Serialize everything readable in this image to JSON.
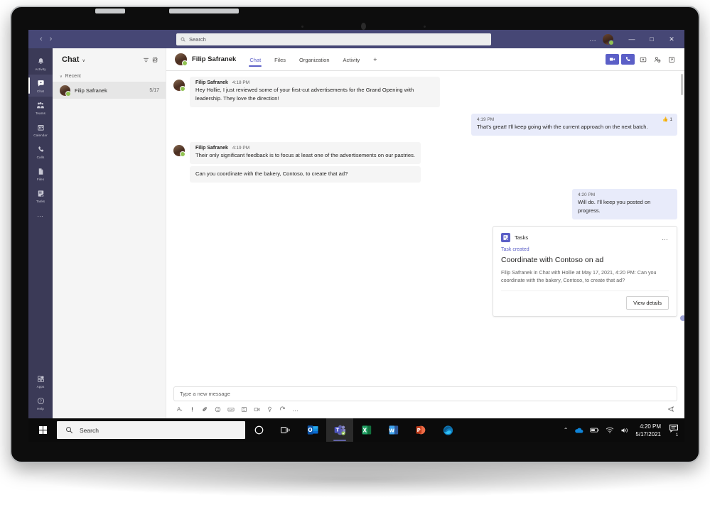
{
  "window": {
    "search_placeholder": "Search",
    "more_label": "…",
    "minimize_label": "—",
    "maximize_label": "□",
    "close_label": "✕",
    "back_label": "‹",
    "forward_label": "›"
  },
  "rail": {
    "items": [
      {
        "label": "Activity",
        "icon": "bell-icon"
      },
      {
        "label": "Chat",
        "icon": "chat-icon"
      },
      {
        "label": "Teams",
        "icon": "teams-icon"
      },
      {
        "label": "Calendar",
        "icon": "calendar-icon"
      },
      {
        "label": "Calls",
        "icon": "phone-icon"
      },
      {
        "label": "Files",
        "icon": "file-icon"
      },
      {
        "label": "Tasks",
        "icon": "tasks-icon"
      }
    ],
    "more_label": "…",
    "bottom_items": [
      {
        "label": "Apps",
        "icon": "apps-icon"
      },
      {
        "label": "Help",
        "icon": "help-icon"
      }
    ]
  },
  "list_pane": {
    "title": "Chat",
    "chevron": "∨",
    "filter_icon": "filter-icon",
    "compose_icon": "new-chat-icon",
    "section_label": "Recent",
    "section_caret": "∨",
    "chats": [
      {
        "name": "Filip Safranek",
        "time": "5/17"
      }
    ]
  },
  "conversation": {
    "contact_name": "Filip Safranek",
    "tabs": [
      {
        "label": "Chat",
        "active": true
      },
      {
        "label": "Files",
        "active": false
      },
      {
        "label": "Organization",
        "active": false
      },
      {
        "label": "Activity",
        "active": false
      }
    ],
    "add_tab_label": "+",
    "actions": [
      {
        "name": "video-call-button",
        "icon": "video-icon"
      },
      {
        "name": "audio-call-button",
        "icon": "phone-icon"
      },
      {
        "name": "share-screen-button",
        "icon": "share-screen-icon"
      },
      {
        "name": "add-people-button",
        "icon": "add-people-icon"
      },
      {
        "name": "popout-chat-button",
        "icon": "popout-icon"
      }
    ],
    "messages": [
      {
        "side": "left",
        "author": "Filip Safranek",
        "time": "4:18 PM",
        "text": "Hey Hollie, I just reviewed some of your first-cut advertisements for the Grand Opening with leadership. They love the direction!"
      },
      {
        "side": "right",
        "author": "",
        "time": "4:19 PM",
        "text": "That's great! I'll keep going with the current approach on the next batch.",
        "reaction": {
          "emoji": "👍",
          "count": "1"
        }
      },
      {
        "side": "left",
        "author": "Filip Safranek",
        "time": "4:19 PM",
        "text": "Their only significant feedback is to focus at least one of the advertisements on our pastries."
      },
      {
        "side": "left",
        "author": "",
        "time": "",
        "text": "Can you coordinate with the bakery, Contoso, to create that ad?"
      },
      {
        "side": "right",
        "author": "",
        "time": "4:20 PM",
        "text": "Will do. I'll keep you posted on progress."
      }
    ],
    "task_card": {
      "app_name": "Tasks",
      "app_icon": "tasks-icon",
      "more_label": "…",
      "kicker": "Task created",
      "title": "Coordinate with Contoso on ad",
      "body": "Filip Safranek in Chat with Hollie at May 17, 2021, 4:20 PM: Can you coordinate with the bakery, Contoso, to create that ad?",
      "button_label": "View details"
    },
    "compose": {
      "placeholder": "Type a new message",
      "tools": [
        {
          "name": "format-icon"
        },
        {
          "name": "importance-icon"
        },
        {
          "name": "attach-icon"
        },
        {
          "name": "emoji-icon"
        },
        {
          "name": "giphy-icon"
        },
        {
          "name": "sticker-icon"
        },
        {
          "name": "meet-now-icon"
        },
        {
          "name": "praise-icon"
        },
        {
          "name": "loop-icon"
        },
        {
          "name": "more-options-icon"
        }
      ],
      "more_label": "…",
      "send_icon": "send-icon"
    }
  },
  "taskbar": {
    "start_label": "start-icon",
    "search_placeholder": "Search",
    "items": [
      {
        "name": "cortana-icon",
        "accent": "#ffffff"
      },
      {
        "name": "task-view-icon",
        "accent": "#ffffff"
      },
      {
        "name": "outlook-icon",
        "accent": "#0a69d0"
      },
      {
        "name": "teams-icon",
        "accent": "#6264a7"
      },
      {
        "name": "excel-icon",
        "accent": "#21a366"
      },
      {
        "name": "word-icon",
        "accent": "#2b579a"
      },
      {
        "name": "powerpoint-icon",
        "accent": "#d24726"
      },
      {
        "name": "edge-icon",
        "accent": "#0f7ebf"
      }
    ],
    "tray": [
      {
        "name": "show-hidden-icons",
        "glyph": "⌃"
      },
      {
        "name": "onedrive-icon"
      },
      {
        "name": "battery-icon"
      },
      {
        "name": "wifi-icon"
      },
      {
        "name": "volume-icon"
      }
    ],
    "clock_time": "4:20 PM",
    "clock_date": "5/17/2021",
    "notification_count": "1"
  },
  "colors": {
    "teams_purple": "#464775",
    "accent": "#5b5fc7",
    "my_bubble": "#e8ebfa",
    "their_bubble": "#f5f5f5",
    "presence_green": "#92c353"
  }
}
